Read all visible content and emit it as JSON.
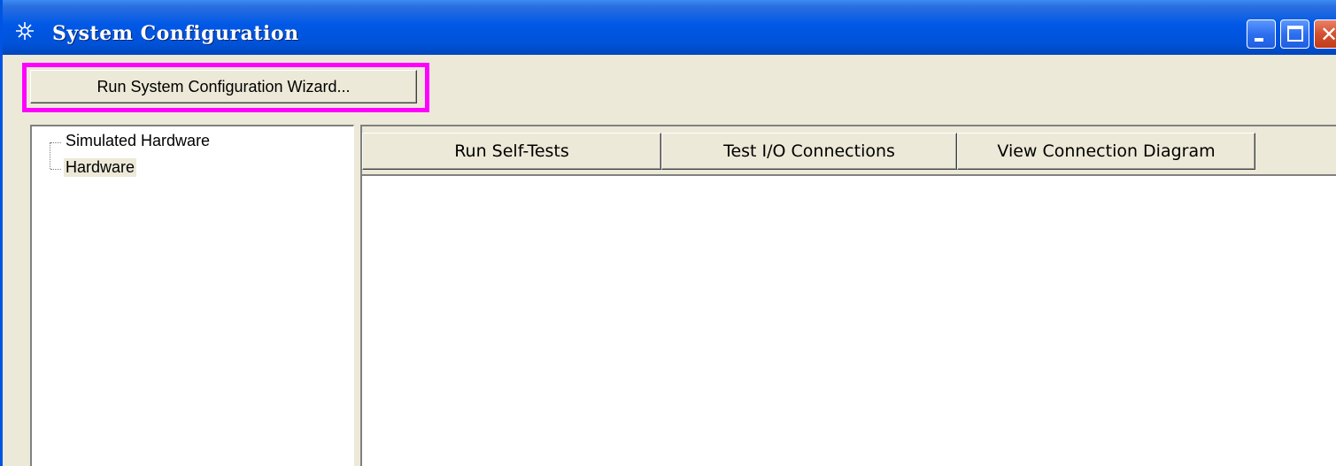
{
  "window": {
    "title": "System Configuration",
    "icon": "starburst-icon",
    "controls": [
      "minimize-icon",
      "maximize-icon",
      "close-icon"
    ]
  },
  "toolbar": {
    "wizard_label": "Run System Configuration Wizard..."
  },
  "tree": {
    "items": [
      {
        "label": "Simulated Hardware",
        "selected": false
      },
      {
        "label": "Hardware",
        "selected": true
      }
    ]
  },
  "tabs": [
    {
      "label": "Run Self-Tests"
    },
    {
      "label": "Test I/O Connections"
    },
    {
      "label": "View Connection Diagram"
    }
  ],
  "colors": {
    "titlebar": "#0058e6",
    "highlight": "#ff00ff",
    "face": "#ece9d8"
  }
}
